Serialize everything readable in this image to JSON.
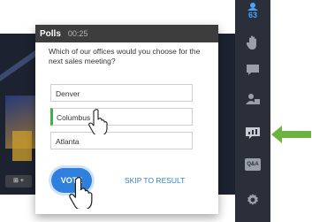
{
  "poll": {
    "title": "Polls",
    "timer": "00:25",
    "question": "Which of our offices would you choose for the next sales meeting?",
    "options": [
      {
        "label": "Denver"
      },
      {
        "label": "Columbus"
      },
      {
        "label": "Atlanta"
      }
    ],
    "selected_option": "Columbus",
    "vote_label": "VOTE",
    "skip_label": "SKIP TO RESULT"
  },
  "toolbar": {
    "attendees_count": "63",
    "items": [
      "attendees-icon",
      "raise-hand-icon",
      "chat-icon",
      "presenter-icon",
      "polls-icon",
      "qa-icon",
      "settings-icon"
    ],
    "qa_label": "Q&A"
  },
  "colors": {
    "accent": "#2f7fdc",
    "selected_marker": "#38b44a",
    "arrow": "#6cb33f",
    "toolbar_bg": "#2a2f3a"
  }
}
